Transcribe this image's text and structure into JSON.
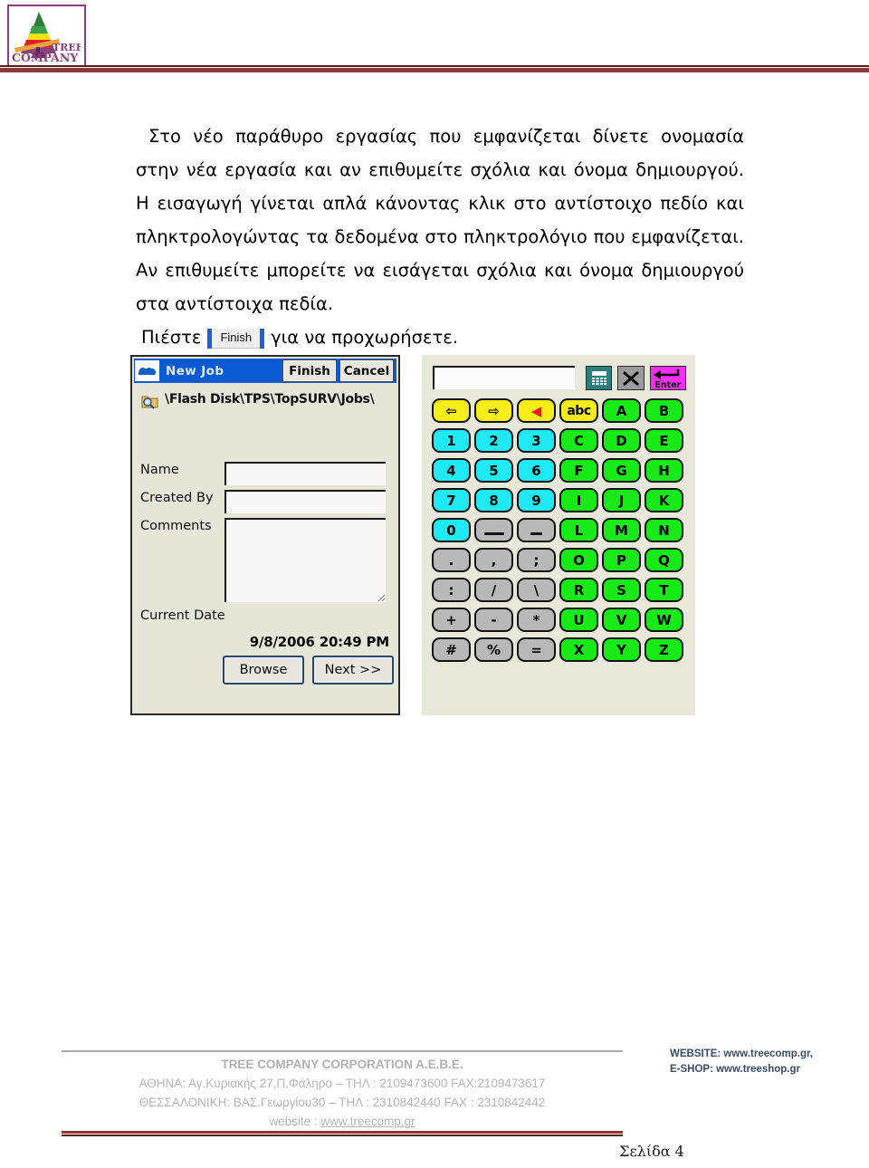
{
  "header": {
    "logo": {
      "icon": "tree-company-logo",
      "line1": "TREE",
      "line2": "COMPANY"
    }
  },
  "document": {
    "paragraph1": "Στο νέο παράθυρο εργασίας που εμφανίζεται δίνετε ονομασία στην νέα εργασία και αν επιθυμείτε σχόλια και όνομα δημιουργού. Η εισαγωγή γίνεται απλά κάνοντας κλικ στο αντίστοιχο πεδίο και πληκτρολογώντας τα δεδομένα στο πληκτρολόγιο που εμφανίζεται. Αν επιθυμείτε μπορείτε να εισάγεται σχόλια και όνομα δημιουργού στα αντίστοιχα πεδία.",
    "press_prefix": "Πιέστε",
    "inline_button_label": "Finish",
    "press_suffix": "για να προχωρήσετε."
  },
  "screenshot": {
    "dialog": {
      "title": "New Job",
      "title_icon": "topcon-logo-icon",
      "buttons": {
        "finish": "Finish",
        "cancel": "Cancel"
      },
      "path_icon": "folder-search-icon",
      "path": "\\Flash Disk\\TPS\\TopSURV\\Jobs\\",
      "fields": [
        {
          "label": "Name",
          "value": "",
          "type": "text"
        },
        {
          "label": "Created By",
          "value": "",
          "type": "text"
        },
        {
          "label": "Comments",
          "value": "",
          "type": "textarea"
        }
      ],
      "current_date_label": "Current Date",
      "current_date_value": "9/8/2006 20:49 PM",
      "browse_button": "Browse",
      "next_button": "Next >>"
    },
    "keyboard": {
      "entry_value": "",
      "top_buttons": [
        {
          "name": "calculator-icon",
          "label": ""
        },
        {
          "name": "close-x-icon",
          "label": ""
        },
        {
          "name": "enter-icon",
          "label": "Enter"
        }
      ],
      "keys": [
        {
          "label": "⇦",
          "color": "yellow",
          "name": "arrow-left-key"
        },
        {
          "label": "⇨",
          "color": "yellow",
          "name": "arrow-right-key"
        },
        {
          "label": "◀",
          "color": "yellow",
          "name": "backspace-key"
        },
        {
          "label": "abc",
          "color": "yellow",
          "name": "abc-key"
        },
        {
          "label": "A",
          "color": "green",
          "name": "key-a"
        },
        {
          "label": "B",
          "color": "green",
          "name": "key-b"
        },
        {
          "label": "1",
          "color": "cyan",
          "name": "key-1"
        },
        {
          "label": "2",
          "color": "cyan",
          "name": "key-2"
        },
        {
          "label": "3",
          "color": "cyan",
          "name": "key-3"
        },
        {
          "label": "C",
          "color": "green",
          "name": "key-c"
        },
        {
          "label": "D",
          "color": "green",
          "name": "key-d"
        },
        {
          "label": "E",
          "color": "green",
          "name": "key-e"
        },
        {
          "label": "4",
          "color": "cyan",
          "name": "key-4"
        },
        {
          "label": "5",
          "color": "cyan",
          "name": "key-5"
        },
        {
          "label": "6",
          "color": "cyan",
          "name": "key-6"
        },
        {
          "label": "F",
          "color": "green",
          "name": "key-f"
        },
        {
          "label": "G",
          "color": "green",
          "name": "key-g"
        },
        {
          "label": "H",
          "color": "green",
          "name": "key-h"
        },
        {
          "label": "7",
          "color": "cyan",
          "name": "key-7"
        },
        {
          "label": "8",
          "color": "cyan",
          "name": "key-8"
        },
        {
          "label": "9",
          "color": "cyan",
          "name": "key-9"
        },
        {
          "label": "I",
          "color": "green",
          "name": "key-i"
        },
        {
          "label": "J",
          "color": "green",
          "name": "key-j"
        },
        {
          "label": "K",
          "color": "green",
          "name": "key-k"
        },
        {
          "label": "0",
          "color": "cyan",
          "name": "key-0"
        },
        {
          "label": "",
          "color": "grey",
          "name": "space-key",
          "glyph": "space"
        },
        {
          "label": "_",
          "color": "grey",
          "name": "underscore-key",
          "glyph": "underscore"
        },
        {
          "label": "L",
          "color": "green",
          "name": "key-l"
        },
        {
          "label": "M",
          "color": "green",
          "name": "key-m"
        },
        {
          "label": "N",
          "color": "green",
          "name": "key-n"
        },
        {
          "label": ".",
          "color": "grey",
          "name": "period-key"
        },
        {
          "label": ",",
          "color": "grey",
          "name": "comma-key"
        },
        {
          "label": ";",
          "color": "grey",
          "name": "semicolon-key"
        },
        {
          "label": "O",
          "color": "green",
          "name": "key-o"
        },
        {
          "label": "P",
          "color": "green",
          "name": "key-p"
        },
        {
          "label": "Q",
          "color": "green",
          "name": "key-q"
        },
        {
          "label": ":",
          "color": "grey",
          "name": "colon-key"
        },
        {
          "label": "/",
          "color": "grey",
          "name": "slash-key"
        },
        {
          "label": "\\",
          "color": "grey",
          "name": "backslash-key"
        },
        {
          "label": "R",
          "color": "green",
          "name": "key-r"
        },
        {
          "label": "S",
          "color": "green",
          "name": "key-s"
        },
        {
          "label": "T",
          "color": "green",
          "name": "key-t"
        },
        {
          "label": "+",
          "color": "grey",
          "name": "plus-key"
        },
        {
          "label": "-",
          "color": "grey",
          "name": "minus-key"
        },
        {
          "label": "*",
          "color": "grey",
          "name": "asterisk-key"
        },
        {
          "label": "U",
          "color": "green",
          "name": "key-u"
        },
        {
          "label": "V",
          "color": "green",
          "name": "key-v"
        },
        {
          "label": "W",
          "color": "green",
          "name": "key-w"
        },
        {
          "label": "#",
          "color": "grey",
          "name": "hash-key"
        },
        {
          "label": "%",
          "color": "grey",
          "name": "percent-key"
        },
        {
          "label": "=",
          "color": "grey",
          "name": "equals-key"
        },
        {
          "label": "X",
          "color": "green",
          "name": "key-x"
        },
        {
          "label": "Y",
          "color": "green",
          "name": "key-y"
        },
        {
          "label": "Z",
          "color": "green",
          "name": "key-z"
        }
      ]
    }
  },
  "footer": {
    "company": "TREE COMPANY CORPORATION A.E.B.E.",
    "line_athens": "ΑΘΗΝΑ: Αγ.Κυριακής 27,Π.Φάληρο – ΤΗΛ : 2109473600 FAX:2109473617",
    "line_thessaloniki": "ΘΕΣΣΑΛΟΝΙΚΗ: ΒΑΣ.Γεωργίου30 – ΤΗΛ : 2310842440  FAX : 2310842442",
    "website_label": "website : ",
    "website_url": "www.treecomp.gr",
    "right_line1": "WEBSITE: www.treecomp.gr,",
    "right_line2": "E-SHOP: www.treeshop.gr",
    "page_label": "Σελίδα 4"
  }
}
